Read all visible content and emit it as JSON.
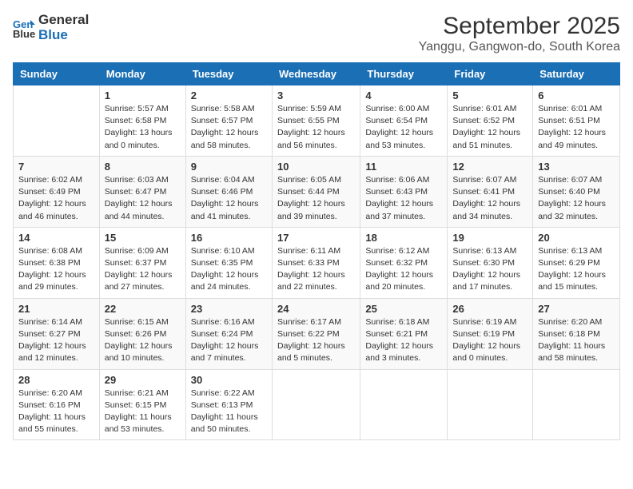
{
  "logo": {
    "line1": "General",
    "line2": "Blue"
  },
  "title": "September 2025",
  "subtitle": "Yanggu, Gangwon-do, South Korea",
  "weekdays": [
    "Sunday",
    "Monday",
    "Tuesday",
    "Wednesday",
    "Thursday",
    "Friday",
    "Saturday"
  ],
  "weeks": [
    [
      {
        "day": "",
        "info": ""
      },
      {
        "day": "1",
        "info": "Sunrise: 5:57 AM\nSunset: 6:58 PM\nDaylight: 13 hours\nand 0 minutes."
      },
      {
        "day": "2",
        "info": "Sunrise: 5:58 AM\nSunset: 6:57 PM\nDaylight: 12 hours\nand 58 minutes."
      },
      {
        "day": "3",
        "info": "Sunrise: 5:59 AM\nSunset: 6:55 PM\nDaylight: 12 hours\nand 56 minutes."
      },
      {
        "day": "4",
        "info": "Sunrise: 6:00 AM\nSunset: 6:54 PM\nDaylight: 12 hours\nand 53 minutes."
      },
      {
        "day": "5",
        "info": "Sunrise: 6:01 AM\nSunset: 6:52 PM\nDaylight: 12 hours\nand 51 minutes."
      },
      {
        "day": "6",
        "info": "Sunrise: 6:01 AM\nSunset: 6:51 PM\nDaylight: 12 hours\nand 49 minutes."
      }
    ],
    [
      {
        "day": "7",
        "info": "Sunrise: 6:02 AM\nSunset: 6:49 PM\nDaylight: 12 hours\nand 46 minutes."
      },
      {
        "day": "8",
        "info": "Sunrise: 6:03 AM\nSunset: 6:47 PM\nDaylight: 12 hours\nand 44 minutes."
      },
      {
        "day": "9",
        "info": "Sunrise: 6:04 AM\nSunset: 6:46 PM\nDaylight: 12 hours\nand 41 minutes."
      },
      {
        "day": "10",
        "info": "Sunrise: 6:05 AM\nSunset: 6:44 PM\nDaylight: 12 hours\nand 39 minutes."
      },
      {
        "day": "11",
        "info": "Sunrise: 6:06 AM\nSunset: 6:43 PM\nDaylight: 12 hours\nand 37 minutes."
      },
      {
        "day": "12",
        "info": "Sunrise: 6:07 AM\nSunset: 6:41 PM\nDaylight: 12 hours\nand 34 minutes."
      },
      {
        "day": "13",
        "info": "Sunrise: 6:07 AM\nSunset: 6:40 PM\nDaylight: 12 hours\nand 32 minutes."
      }
    ],
    [
      {
        "day": "14",
        "info": "Sunrise: 6:08 AM\nSunset: 6:38 PM\nDaylight: 12 hours\nand 29 minutes."
      },
      {
        "day": "15",
        "info": "Sunrise: 6:09 AM\nSunset: 6:37 PM\nDaylight: 12 hours\nand 27 minutes."
      },
      {
        "day": "16",
        "info": "Sunrise: 6:10 AM\nSunset: 6:35 PM\nDaylight: 12 hours\nand 24 minutes."
      },
      {
        "day": "17",
        "info": "Sunrise: 6:11 AM\nSunset: 6:33 PM\nDaylight: 12 hours\nand 22 minutes."
      },
      {
        "day": "18",
        "info": "Sunrise: 6:12 AM\nSunset: 6:32 PM\nDaylight: 12 hours\nand 20 minutes."
      },
      {
        "day": "19",
        "info": "Sunrise: 6:13 AM\nSunset: 6:30 PM\nDaylight: 12 hours\nand 17 minutes."
      },
      {
        "day": "20",
        "info": "Sunrise: 6:13 AM\nSunset: 6:29 PM\nDaylight: 12 hours\nand 15 minutes."
      }
    ],
    [
      {
        "day": "21",
        "info": "Sunrise: 6:14 AM\nSunset: 6:27 PM\nDaylight: 12 hours\nand 12 minutes."
      },
      {
        "day": "22",
        "info": "Sunrise: 6:15 AM\nSunset: 6:26 PM\nDaylight: 12 hours\nand 10 minutes."
      },
      {
        "day": "23",
        "info": "Sunrise: 6:16 AM\nSunset: 6:24 PM\nDaylight: 12 hours\nand 7 minutes."
      },
      {
        "day": "24",
        "info": "Sunrise: 6:17 AM\nSunset: 6:22 PM\nDaylight: 12 hours\nand 5 minutes."
      },
      {
        "day": "25",
        "info": "Sunrise: 6:18 AM\nSunset: 6:21 PM\nDaylight: 12 hours\nand 3 minutes."
      },
      {
        "day": "26",
        "info": "Sunrise: 6:19 AM\nSunset: 6:19 PM\nDaylight: 12 hours\nand 0 minutes."
      },
      {
        "day": "27",
        "info": "Sunrise: 6:20 AM\nSunset: 6:18 PM\nDaylight: 11 hours\nand 58 minutes."
      }
    ],
    [
      {
        "day": "28",
        "info": "Sunrise: 6:20 AM\nSunset: 6:16 PM\nDaylight: 11 hours\nand 55 minutes."
      },
      {
        "day": "29",
        "info": "Sunrise: 6:21 AM\nSunset: 6:15 PM\nDaylight: 11 hours\nand 53 minutes."
      },
      {
        "day": "30",
        "info": "Sunrise: 6:22 AM\nSunset: 6:13 PM\nDaylight: 11 hours\nand 50 minutes."
      },
      {
        "day": "",
        "info": ""
      },
      {
        "day": "",
        "info": ""
      },
      {
        "day": "",
        "info": ""
      },
      {
        "day": "",
        "info": ""
      }
    ]
  ]
}
